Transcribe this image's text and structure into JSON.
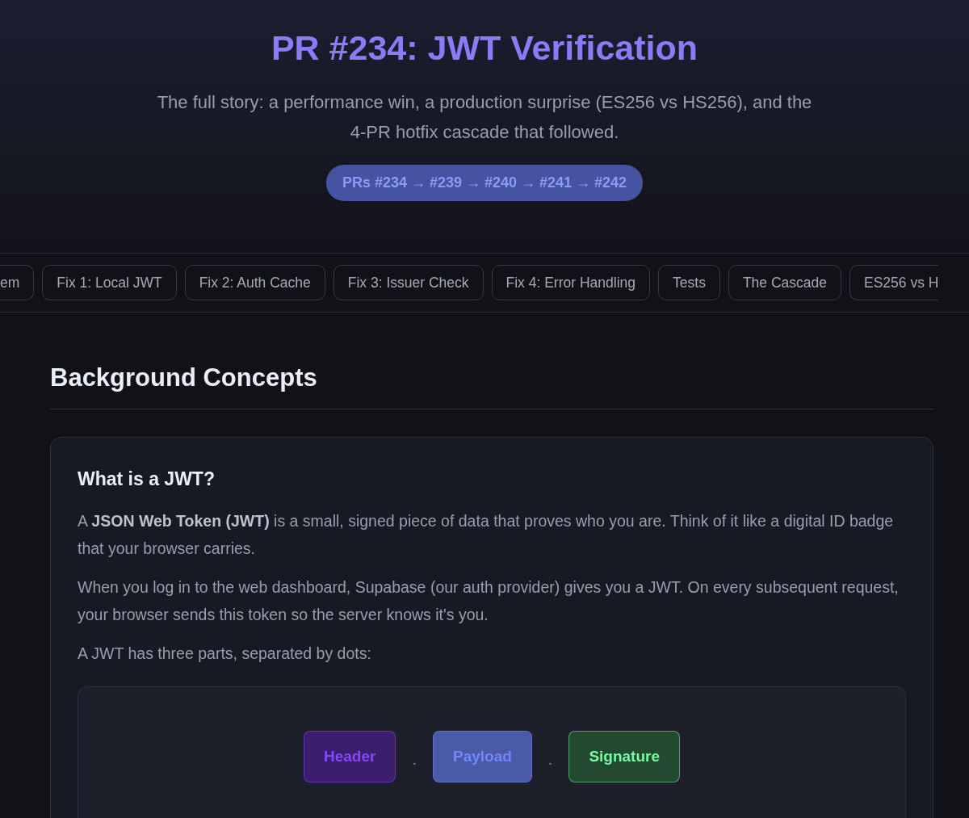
{
  "header": {
    "title": "PR #234: JWT Verification",
    "subtitle": "The full story: a performance win, a production surprise (ES256 vs HS256), and the 4-PR hotfix cascade that followed.",
    "badge": "PRs #234 → #239 → #240 → #241 → #242"
  },
  "nav": [
    {
      "label": "em"
    },
    {
      "label": "Fix 1: Local JWT"
    },
    {
      "label": "Fix 2: Auth Cache"
    },
    {
      "label": "Fix 3: Issuer Check"
    },
    {
      "label": "Fix 4: Error Handling"
    },
    {
      "label": "Tests"
    },
    {
      "label": "The Cascade"
    },
    {
      "label": "ES256 vs H"
    }
  ],
  "section": {
    "heading": "Background Concepts",
    "card": {
      "title": "What is a JWT?",
      "paragraphs": [
        "A **JSON Web Token (JWT)** is a small, signed piece of data that proves who you are. Think of it like a digital ID badge that your browser carries.",
        "When you log in to the web dashboard, Supabase (our auth provider) gives you a JWT. On every subsequent request, your browser sends this token so the server knows it's you.",
        "A JWT has three parts, separated by dots:"
      ],
      "jwt_parts": [
        {
          "label": "Header",
          "color": "#3b1f6e"
        },
        {
          "label": "Payload",
          "color": "#4b5aa6"
        },
        {
          "label": "Signature",
          "color": "#234a30"
        }
      ],
      "separator": "."
    }
  }
}
